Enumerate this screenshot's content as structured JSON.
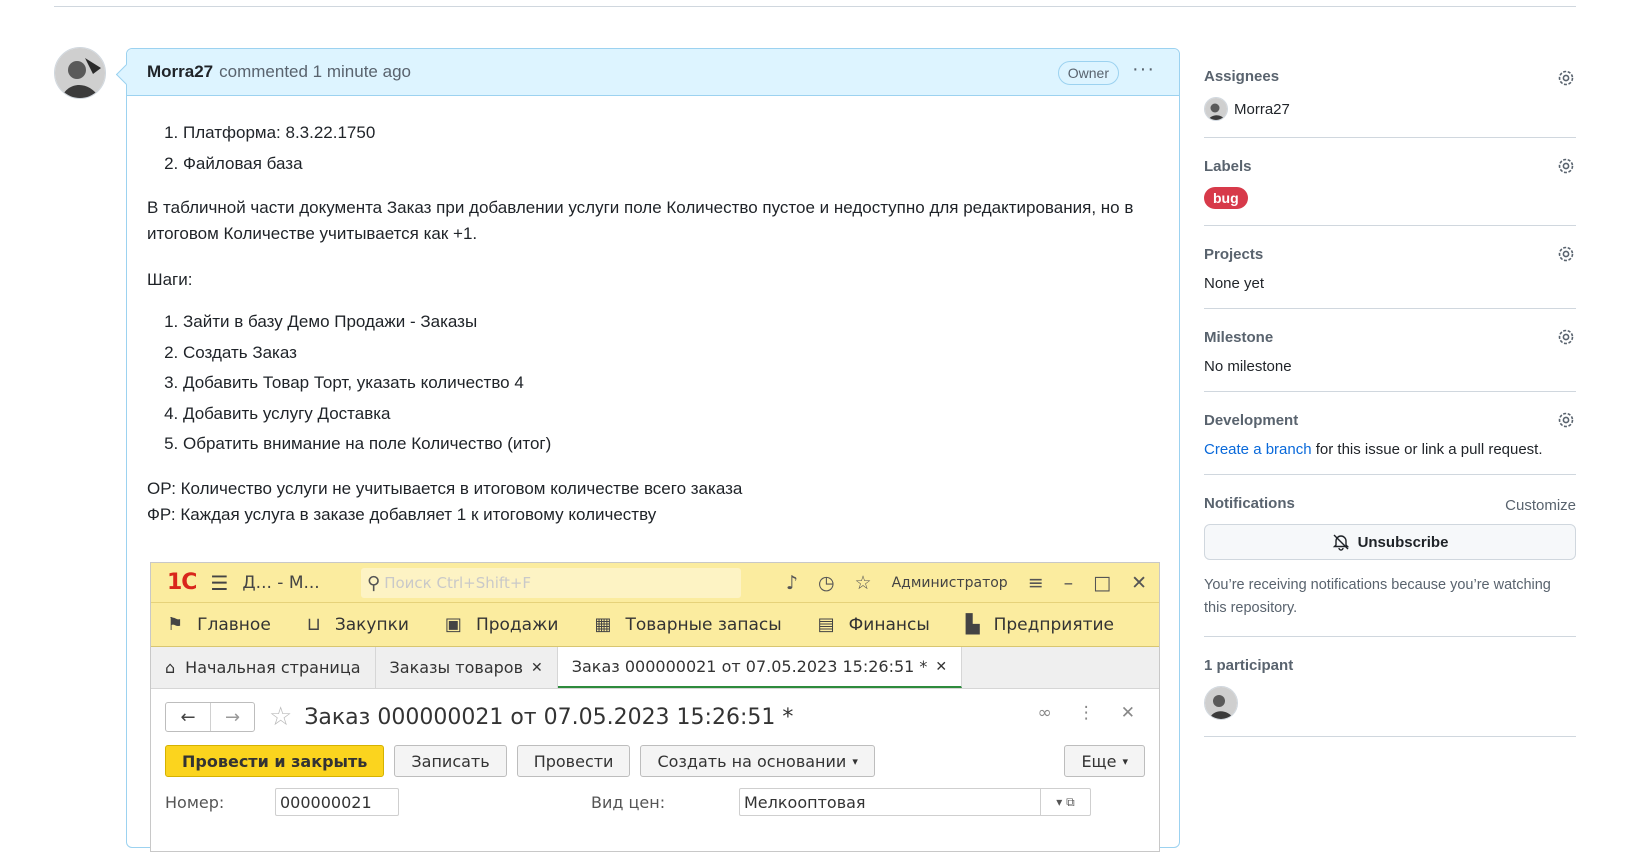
{
  "comment": {
    "author": "Morra27",
    "meta": "commented 1 minute ago",
    "badge": "Owner",
    "env_items": [
      "Платформа: 8.3.22.1750",
      "Файловая база"
    ],
    "description": "В табличной части документа Заказ при добавлении услуги поле Количество пустое и недоступно для редактирования, но в итоговом Количестве учитывается как +1.",
    "steps_heading": "Шаги:",
    "steps": [
      "Зайти в базу Демо Продажи - Заказы",
      "Создать Заказ",
      "Добавить Товар Торт, указать количество 4",
      "Добавить услугу Доставка",
      "Обратить внимание на поле Количество (итог)"
    ],
    "expected": "ОР: Количество услуги не учитывается в итоговом количестве всего заказа",
    "actual": "ФР: Каждая услуга в заказе добавляет 1 к итоговому количеству"
  },
  "screenshot_1c": {
    "logo": "1С",
    "window_title": "Д... - М...",
    "search_placeholder": "Поиск Ctrl+Shift+F",
    "user": "Администратор",
    "sections": [
      "Главное",
      "Закупки",
      "Продажи",
      "Товарные запасы",
      "Финансы",
      "Предприятие"
    ],
    "tabs": [
      "Начальная страница",
      "Заказы товаров",
      "Заказ 000000021 от 07.05.2023 15:26:51 *"
    ],
    "form_title": "Заказ 000000021 от 07.05.2023 15:26:51 *",
    "buttons": {
      "post_close": "Провести и закрыть",
      "save": "Записать",
      "post": "Провести",
      "create_based": "Создать на основании",
      "more": "Еще"
    },
    "fields": {
      "number_label": "Номер:",
      "number_value": "000000021",
      "price_type_label": "Вид цен:",
      "price_type_value": "Мелкооптовая"
    }
  },
  "sidebar": {
    "assignees": {
      "title": "Assignees",
      "user": "Morra27"
    },
    "labels": {
      "title": "Labels",
      "label": "bug",
      "label_color": "#d73a4a"
    },
    "projects": {
      "title": "Projects",
      "value": "None yet"
    },
    "milestone": {
      "title": "Milestone",
      "value": "No milestone"
    },
    "development": {
      "title": "Development",
      "link": "Create a branch",
      "rest": " for this issue or link a pull request."
    },
    "notifications": {
      "title": "Notifications",
      "customize": "Customize",
      "button": "Unsubscribe",
      "note": "You’re receiving notifications because you’re watching this repository."
    },
    "participants": {
      "title": "1 participant"
    }
  }
}
